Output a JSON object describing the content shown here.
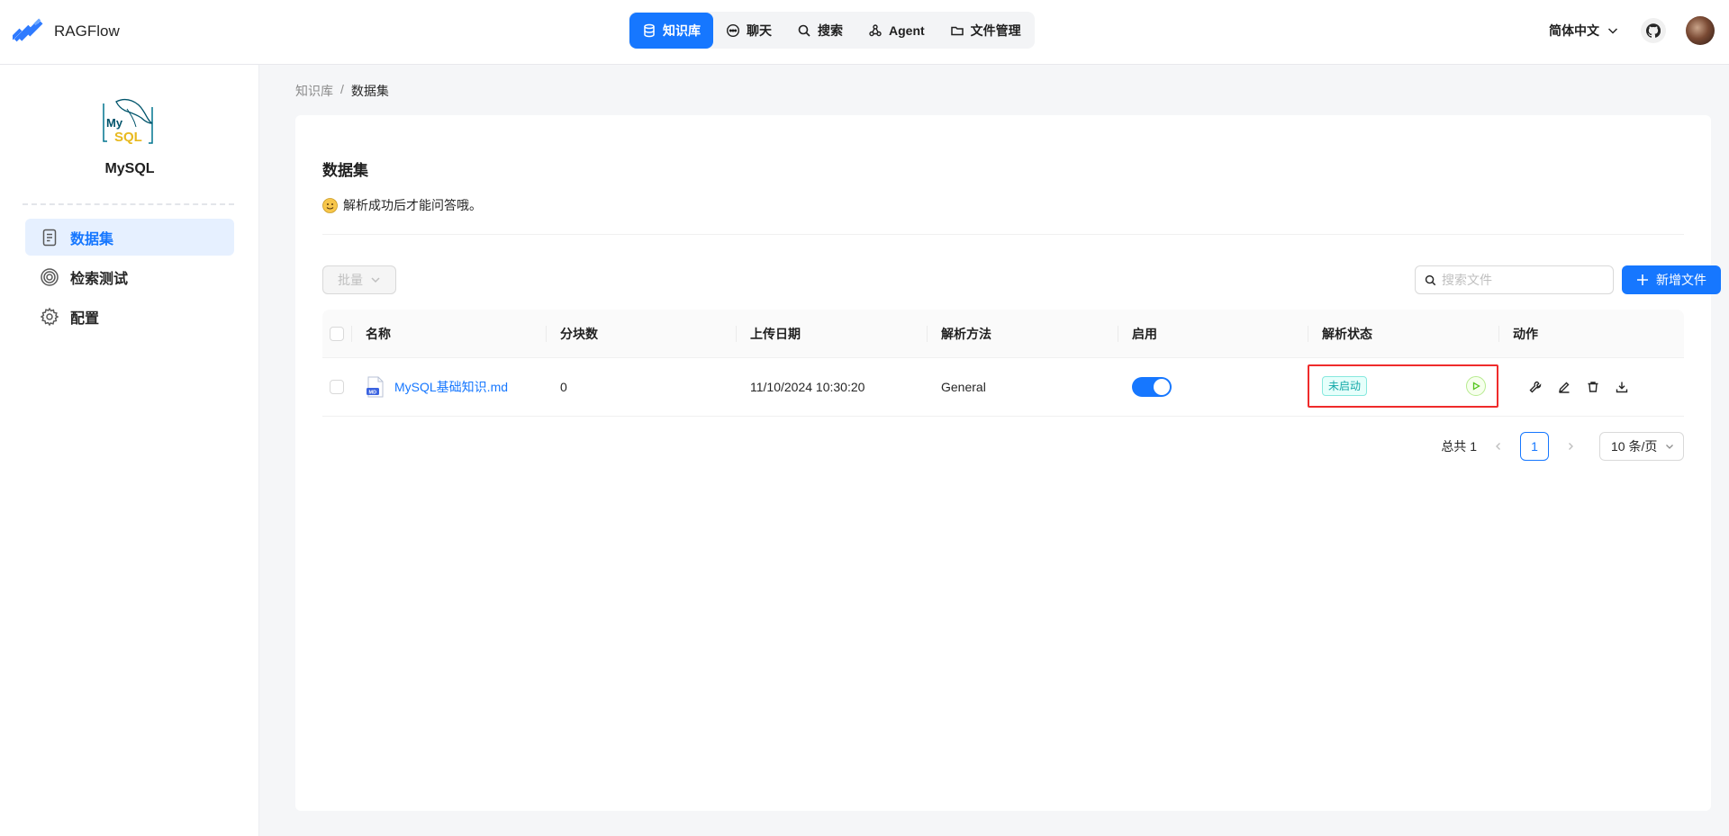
{
  "app": {
    "name": "RAGFlow"
  },
  "nav": {
    "items": [
      {
        "label": "知识库",
        "icon": "database-icon",
        "active": true
      },
      {
        "label": "聊天",
        "icon": "chat-icon",
        "active": false
      },
      {
        "label": "搜索",
        "icon": "search-icon",
        "active": false
      },
      {
        "label": "Agent",
        "icon": "agent-icon",
        "active": false
      },
      {
        "label": "文件管理",
        "icon": "folder-icon",
        "active": false
      }
    ]
  },
  "header": {
    "language": "简体中文"
  },
  "sidebar": {
    "kb_name": "MySQL",
    "items": [
      {
        "label": "数据集",
        "icon": "document-icon",
        "active": true
      },
      {
        "label": "检索测试",
        "icon": "target-icon",
        "active": false
      },
      {
        "label": "配置",
        "icon": "gear-icon",
        "active": false
      }
    ]
  },
  "breadcrumb": {
    "root": "知识库",
    "separator": "/",
    "current": "数据集"
  },
  "dataset": {
    "title": "数据集",
    "description": "解析成功后才能问答哦。",
    "batch_label": "批量",
    "search_placeholder": "搜索文件",
    "add_label": "新增文件"
  },
  "table": {
    "headers": [
      "名称",
      "分块数",
      "上传日期",
      "解析方法",
      "启用",
      "解析状态",
      "动作"
    ],
    "rows": [
      {
        "name": "MySQL基础知识.md",
        "chunks": "0",
        "upload_date": "11/10/2024 10:30:20",
        "method": "General",
        "enabled": true,
        "status": "未启动"
      }
    ]
  },
  "pagination": {
    "total": "总共 1",
    "current": "1",
    "page_size": "10 条/页"
  },
  "colors": {
    "primary": "#1677ff",
    "status_highlight": "#ef2b2b",
    "status_tag": "#13a8a8"
  }
}
